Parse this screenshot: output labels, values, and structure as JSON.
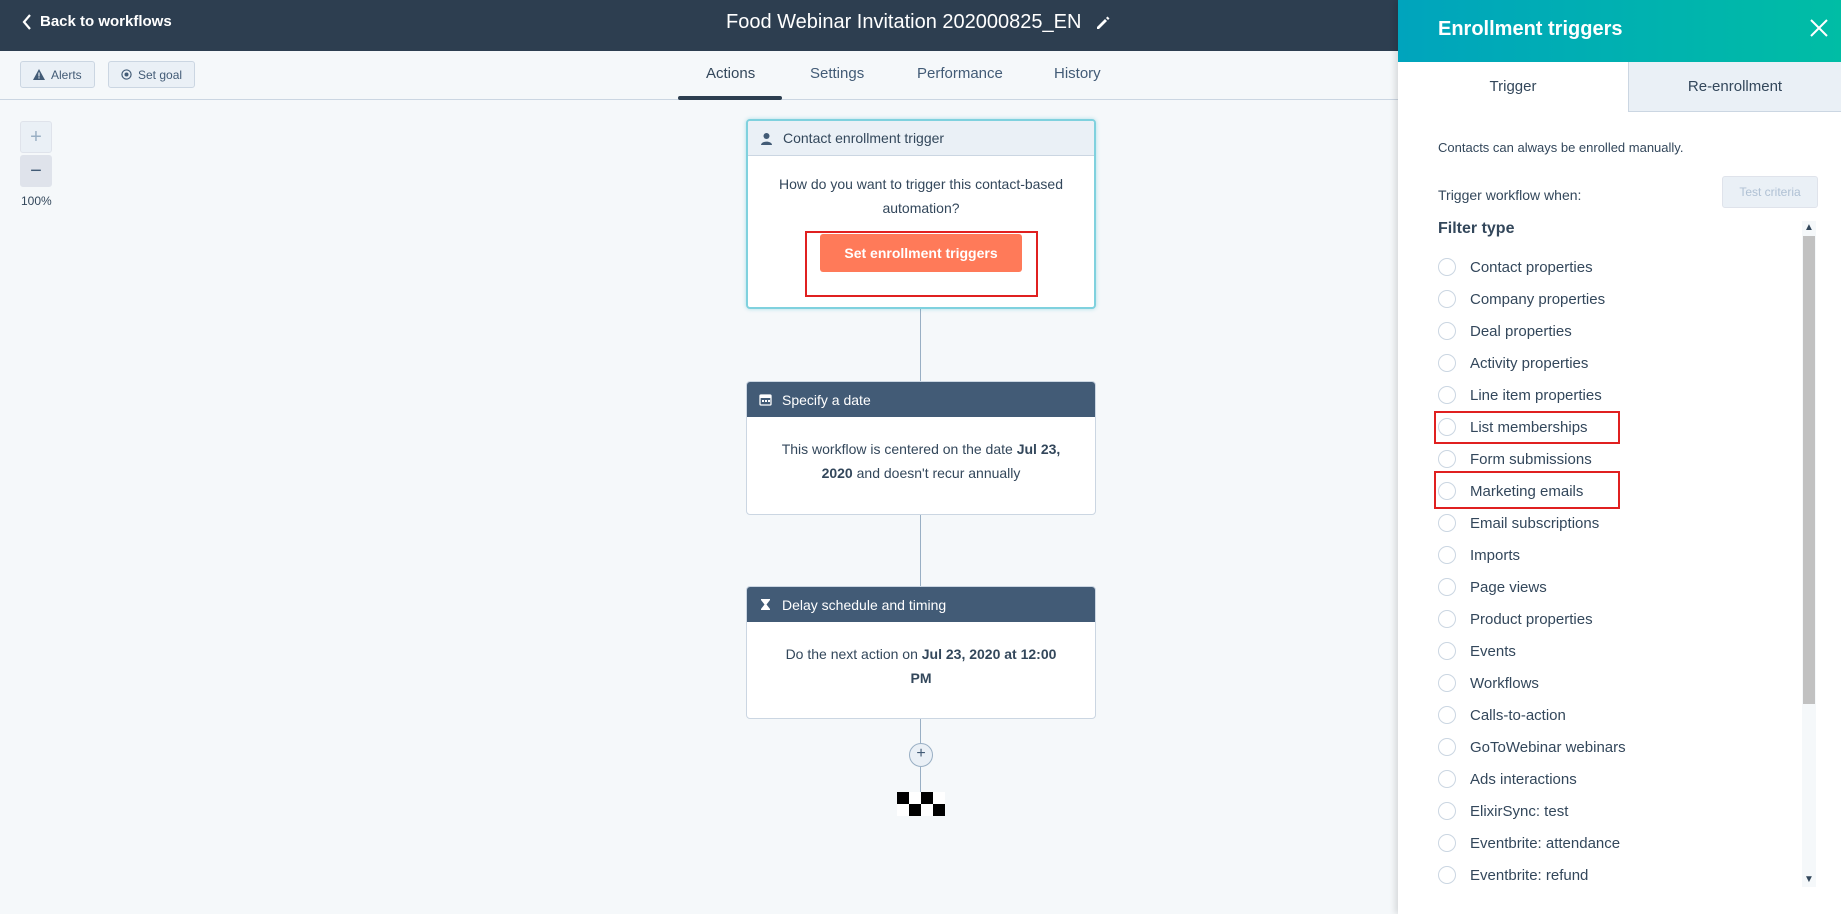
{
  "header": {
    "back_label": "Back to workflows",
    "workflow_title": "Food Webinar Invitation 202000825_EN"
  },
  "toolbar": {
    "alerts_label": "Alerts",
    "goal_label": "Set goal"
  },
  "tabs": [
    {
      "label": "Actions",
      "active": true
    },
    {
      "label": "Settings",
      "active": false
    },
    {
      "label": "Performance",
      "active": false
    },
    {
      "label": "History",
      "active": false
    }
  ],
  "zoom": {
    "plus": "+",
    "minus": "−",
    "level": "100%"
  },
  "cards": {
    "trigger": {
      "header": "Contact enrollment trigger",
      "question": "How do you want to trigger this contact-based automation?",
      "button": "Set enrollment triggers"
    },
    "date": {
      "header": "Specify a date",
      "text_pre": "This workflow is centered on the date ",
      "date": "Jul 23, 2020",
      "text_post": " and doesn't recur annually"
    },
    "delay": {
      "header": "Delay schedule and timing",
      "text_pre": "Do the next action on ",
      "when": "Jul 23, 2020 at 12:00 PM"
    }
  },
  "add_action": "+",
  "panel": {
    "title": "Enrollment triggers",
    "tabs": [
      "Trigger",
      "Re-enrollment"
    ],
    "note": "Contacts can always be enrolled manually.",
    "trigger_when": "Trigger workflow when:",
    "test_button": "Test criteria",
    "filter_title": "Filter type",
    "filters": [
      "Contact properties",
      "Company properties",
      "Deal properties",
      "Activity properties",
      "Line item properties",
      "List memberships",
      "Form submissions",
      "Marketing emails",
      "Email subscriptions",
      "Imports",
      "Page views",
      "Product properties",
      "Events",
      "Workflows",
      "Calls-to-action",
      "GoToWebinar webinars",
      "Ads interactions",
      "ElixirSync: test",
      "Eventbrite: attendance",
      "Eventbrite: refund"
    ]
  },
  "colors": {
    "topbar": "#2d3e50",
    "accent_button": "#ff7a59",
    "panel_header_start": "#00a4bd",
    "panel_header_end": "#00bda5",
    "highlight_box": "#e02020"
  }
}
